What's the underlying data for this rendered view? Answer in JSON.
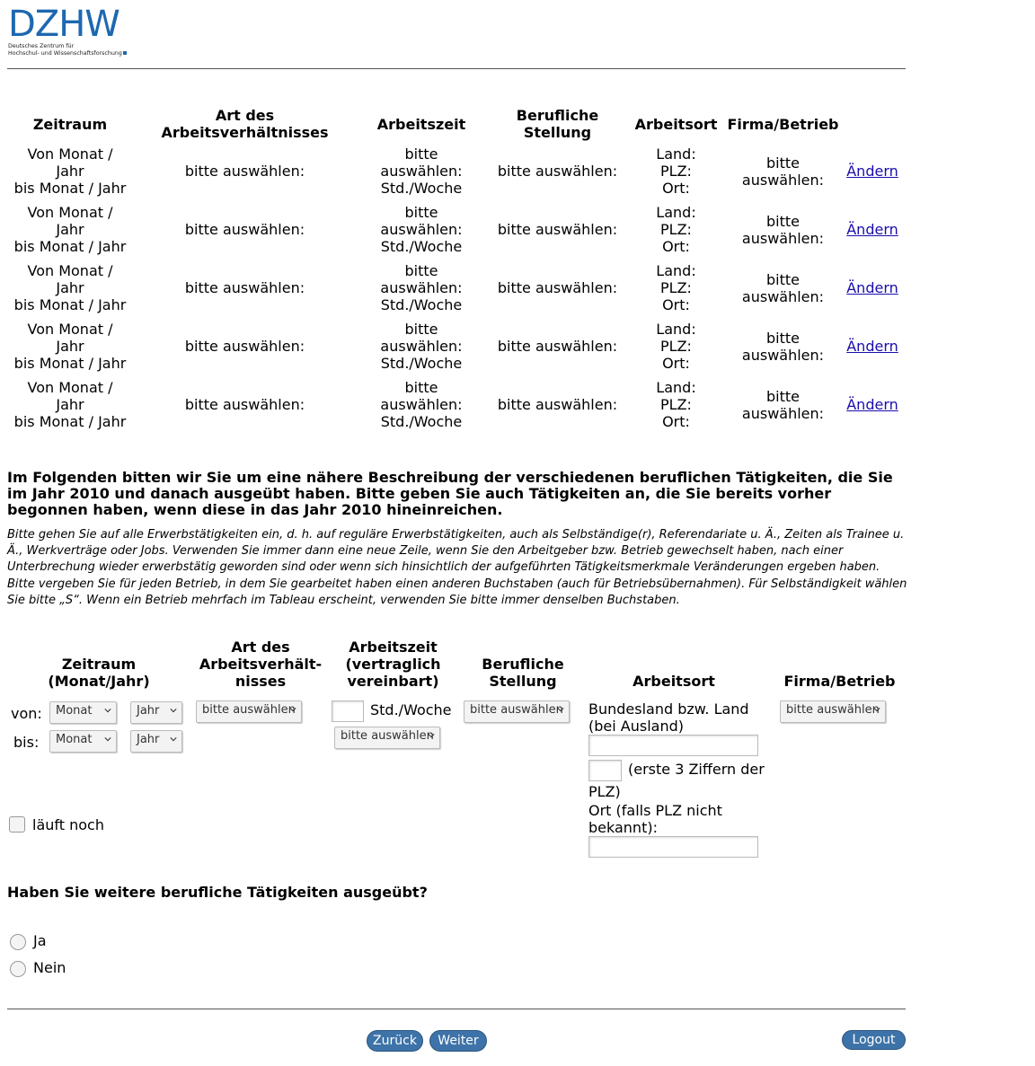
{
  "logo": {
    "wordmark": "DZHW",
    "subline_1": "Deutsches Zentrum für",
    "subline_2": "Hochschul- und Wissenschaftsforschung"
  },
  "summary_table": {
    "headers": [
      "Zeitraum",
      "Art des Arbeitsverhältnisses",
      "Arbeitszeit",
      "Berufliche Stellung",
      "Arbeitsort",
      "Firma/Betrieb"
    ],
    "rows": [
      {
        "zeitraum_1": "Von Monat /",
        "zeitraum_2": "Jahr",
        "zeitraum_3": "bis Monat / Jahr",
        "art": "bitte auswählen:",
        "az_1": "bitte",
        "az_2": "auswählen:",
        "az_3": "Std./Woche",
        "stellung": "bitte auswählen:",
        "ort_1": "Land:",
        "ort_2": "PLZ:",
        "ort_3": "Ort:",
        "firma_1": "bitte",
        "firma_2": "auswählen:",
        "link": "Ändern"
      },
      {
        "zeitraum_1": "Von Monat /",
        "zeitraum_2": "Jahr",
        "zeitraum_3": "bis Monat / Jahr",
        "art": "bitte auswählen:",
        "az_1": "bitte",
        "az_2": "auswählen:",
        "az_3": "Std./Woche",
        "stellung": "bitte auswählen:",
        "ort_1": "Land:",
        "ort_2": "PLZ:",
        "ort_3": "Ort:",
        "firma_1": "bitte",
        "firma_2": "auswählen:",
        "link": "Ändern"
      },
      {
        "zeitraum_1": "Von Monat /",
        "zeitraum_2": "Jahr",
        "zeitraum_3": "bis Monat / Jahr",
        "art": "bitte auswählen:",
        "az_1": "bitte",
        "az_2": "auswählen:",
        "az_3": "Std./Woche",
        "stellung": "bitte auswählen:",
        "ort_1": "Land:",
        "ort_2": "PLZ:",
        "ort_3": "Ort:",
        "firma_1": "bitte",
        "firma_2": "auswählen:",
        "link": "Ändern"
      },
      {
        "zeitraum_1": "Von Monat /",
        "zeitraum_2": "Jahr",
        "zeitraum_3": "bis Monat / Jahr",
        "art": "bitte auswählen:",
        "az_1": "bitte",
        "az_2": "auswählen:",
        "az_3": "Std./Woche",
        "stellung": "bitte auswählen:",
        "ort_1": "Land:",
        "ort_2": "PLZ:",
        "ort_3": "Ort:",
        "firma_1": "bitte",
        "firma_2": "auswählen:",
        "link": "Ändern"
      },
      {
        "zeitraum_1": "Von Monat /",
        "zeitraum_2": "Jahr",
        "zeitraum_3": "bis Monat / Jahr",
        "art": "bitte auswählen:",
        "az_1": "bitte",
        "az_2": "auswählen:",
        "az_3": "Std./Woche",
        "stellung": "bitte auswählen:",
        "ort_1": "Land:",
        "ort_2": "PLZ:",
        "ort_3": "Ort:",
        "firma_1": "bitte",
        "firma_2": "auswählen:",
        "link": "Ändern"
      }
    ]
  },
  "intro": {
    "bold": "Im Folgenden bitten wir Sie um eine nähere Beschreibung der verschiedenen beruflichen Tätigkeiten, die Sie im Jahr 2010 und danach ausgeübt haben. Bitte geben Sie auch Tätigkeiten an, die Sie bereits vorher begonnen haben, wenn diese in das Jahr 2010 hineinreichen.",
    "italic_1": "Bitte gehen Sie auf alle Erwerbstätigkeiten ein, d. h. auf reguläre Erwerbstätigkeiten, auch als Selbständige(r), Referendariate u. Ä., Zeiten als Trainee u. Ä., Werkverträge oder Jobs. Verwenden Sie immer dann eine neue Zeile, wenn Sie den Arbeitgeber bzw. Betrieb gewechselt haben, nach einer Unterbrechung wieder erwerbstätig geworden sind oder wenn sich hinsichtlich der aufgeführten Tätigkeitsmerkmale Veränderungen ergeben haben.",
    "italic_2": "Bitte vergeben Sie für jeden Betrieb, in dem Sie gearbeitet haben einen anderen Buchstaben (auch für Betriebsübernahmen). Für Selbständigkeit wählen Sie bitte „S“. Wenn ein Betrieb mehrfach im Tableau erscheint, verwenden Sie bitte immer denselben Buchstaben."
  },
  "form": {
    "hdr_zeitraum_1": "Zeitraum",
    "hdr_zeitraum_2": "(Monat/Jahr)",
    "hdr_art_1": "Art des",
    "hdr_art_2": "Arbeitsverhält-",
    "hdr_art_3": "nisses",
    "hdr_az_1": "Arbeitszeit",
    "hdr_az_2": "(vertraglich",
    "hdr_az_3": "vereinbart)",
    "hdr_stellung_1": "Berufliche",
    "hdr_stellung_2": "Stellung",
    "hdr_arbeitsort": "Arbeitsort",
    "hdr_firma": "Firma/Betrieb",
    "von_label": "von:",
    "bis_label": "bis:",
    "monat": "Monat",
    "jahr": "Jahr",
    "select_placeholder": "bitte auswählen",
    "std_woche": "Std./Woche",
    "bundesland_1": "Bundesland bzw. Land",
    "bundesland_2": "(bei Ausland)",
    "plz_1": "(erste 3 Ziffern der",
    "plz_2": "PLZ)",
    "ort_1": "Ort (falls PLZ nicht",
    "ort_2": "bekannt):",
    "laeuft_noch": "läuft noch"
  },
  "question": {
    "text": "Haben Sie weitere berufliche Tätigkeiten ausgeübt?",
    "options": [
      "Ja",
      "Nein"
    ]
  },
  "buttons": {
    "back": "Zurück",
    "next": "Weiter",
    "logout": "Logout"
  }
}
